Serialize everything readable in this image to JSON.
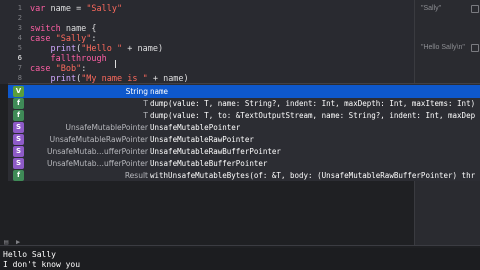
{
  "editor": {
    "line_numbers": [
      "1",
      "2",
      "3",
      "4",
      "5",
      "6",
      "7",
      "8"
    ],
    "lines": [
      [
        {
          "t": "var ",
          "c": "kw"
        },
        {
          "t": "name = ",
          "c": "id"
        },
        {
          "t": "\"Sally\"",
          "c": "str"
        }
      ],
      [],
      [
        {
          "t": "switch ",
          "c": "kw"
        },
        {
          "t": "name {",
          "c": "id"
        }
      ],
      [
        {
          "t": "case ",
          "c": "kw"
        },
        {
          "t": "\"Sally\"",
          "c": "str"
        },
        {
          "t": ":",
          "c": "id"
        }
      ],
      [
        {
          "t": "    print",
          "c": "fn"
        },
        {
          "t": "(",
          "c": "id"
        },
        {
          "t": "\"Hello \"",
          "c": "str"
        },
        {
          "t": " + name)",
          "c": "id"
        }
      ],
      [
        {
          "t": "    fallthrough",
          "c": "kw"
        }
      ],
      [
        {
          "t": "case ",
          "c": "kw"
        },
        {
          "t": "\"Bob\"",
          "c": "str"
        },
        {
          "t": ":",
          "c": "id"
        }
      ],
      [
        {
          "t": "    print",
          "c": "fn"
        },
        {
          "t": "(",
          "c": "id"
        },
        {
          "t": "\"My name is \"",
          "c": "str"
        },
        {
          "t": " + name)",
          "c": "id"
        }
      ]
    ]
  },
  "results": {
    "items": [
      "\"Sally\"",
      "\"Hello Sally\\n\""
    ]
  },
  "autocomplete": {
    "rows": [
      {
        "badge": "V",
        "kind": "v",
        "type": "String",
        "completion": "name",
        "selected": true
      },
      {
        "badge": "f",
        "kind": "f",
        "type": "T",
        "completion": "dump(value: T, name: String?, indent: Int, maxDepth: Int, maxItems: Int)",
        "selected": false
      },
      {
        "badge": "f",
        "kind": "f",
        "type": "T",
        "completion": "dump(value: T, to: &TextOutputStream, name: String?, indent: Int, maxDep",
        "selected": false
      },
      {
        "badge": "S",
        "kind": "s",
        "type": "UnsafeMutablePointer",
        "completion": "UnsafeMutablePointer",
        "selected": false
      },
      {
        "badge": "S",
        "kind": "s",
        "type": "UnsafeMutableRawPointer",
        "completion": "UnsafeMutableRawPointer",
        "selected": false
      },
      {
        "badge": "S",
        "kind": "s",
        "type": "UnsafeMutab…ufferPointer",
        "completion": "UnsafeMutableRawBufferPointer",
        "selected": false
      },
      {
        "badge": "S",
        "kind": "s",
        "type": "UnsafeMutab…ufferPointer",
        "completion": "UnsafeMutableBufferPointer",
        "selected": false
      },
      {
        "badge": "f",
        "kind": "f",
        "type": "Result",
        "completion": "withUnsafeMutableBytes(of: &T, body: (UnsafeMutableRawBufferPointer) thr",
        "selected": false
      }
    ]
  },
  "toolbar": {
    "icons": [
      "console-toggle-icon",
      "play-icon"
    ],
    "glyph_left": "▤",
    "glyph_right": "▶"
  },
  "console": {
    "lines": [
      "Hello Sally",
      "I don't know you"
    ]
  },
  "colors": {
    "accent": "#0e58cc",
    "editor_bg": "#292a30",
    "keyword": "#fc5fa3",
    "string": "#fc6a5d"
  }
}
